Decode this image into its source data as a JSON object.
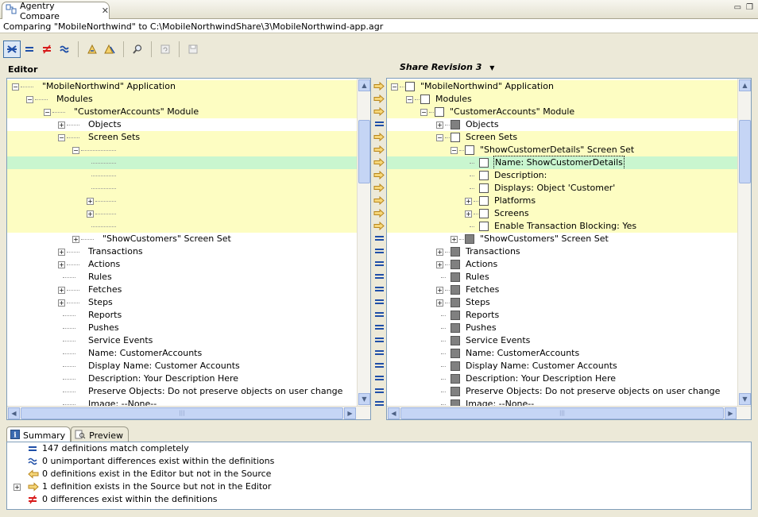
{
  "window": {
    "tab_title": "Agentry Compare",
    "comparing_path": "Comparing \"MobileNorthwind\" to C:\\MobileNorthwindShare\\3\\MobileNorthwind-app.agr"
  },
  "toolbar": {
    "buttons": [
      "show-all",
      "matches",
      "differences",
      "unimportant-differences",
      "copy-left",
      "copy-all",
      "find",
      "refresh",
      "save"
    ]
  },
  "left": {
    "heading": "Editor",
    "rows": [
      {
        "label": "\"MobileNorthwind\" Application",
        "hl": true
      },
      {
        "label": "Modules",
        "hl": true
      },
      {
        "label": "\"CustomerAccounts\" Module",
        "hl": true
      },
      {
        "label": "Objects",
        "hl": false
      },
      {
        "label": "Screen Sets",
        "hl": true
      },
      {
        "label": "",
        "hl": true
      },
      {
        "label": "",
        "hl": "green"
      },
      {
        "label": "",
        "hl": true
      },
      {
        "label": "",
        "hl": true
      },
      {
        "label": "",
        "hl": true
      },
      {
        "label": "",
        "hl": true
      },
      {
        "label": "",
        "hl": true
      },
      {
        "label": "\"ShowCustomers\" Screen Set",
        "hl": false
      },
      {
        "label": "Transactions",
        "hl": false
      },
      {
        "label": "Actions",
        "hl": false
      },
      {
        "label": "Rules",
        "hl": false
      },
      {
        "label": "Fetches",
        "hl": false
      },
      {
        "label": "Steps",
        "hl": false
      },
      {
        "label": "Reports",
        "hl": false
      },
      {
        "label": "Pushes",
        "hl": false
      },
      {
        "label": "Service Events",
        "hl": false
      },
      {
        "label": "Name: CustomerAccounts",
        "hl": false
      },
      {
        "label": "Display Name: Customer Accounts",
        "hl": false
      },
      {
        "label": "Description: Your Description Here",
        "hl": false
      },
      {
        "label": "Preserve Objects: Do not preserve objects on user change",
        "hl": false
      },
      {
        "label": "Image: --None--",
        "hl": false
      }
    ]
  },
  "right": {
    "heading": "Share Revision 3",
    "rows": [
      {
        "label": "\"MobileNorthwind\" Application",
        "hl": true
      },
      {
        "label": "Modules",
        "hl": true
      },
      {
        "label": "\"CustomerAccounts\" Module",
        "hl": true
      },
      {
        "label": "Objects",
        "hl": false
      },
      {
        "label": "Screen Sets",
        "hl": true
      },
      {
        "label": "\"ShowCustomerDetails\" Screen Set",
        "hl": true
      },
      {
        "label": "Name: ShowCustomerDetails",
        "hl": "green"
      },
      {
        "label": "Description:",
        "hl": true
      },
      {
        "label": "Displays: Object 'Customer'",
        "hl": true
      },
      {
        "label": "Platforms",
        "hl": true
      },
      {
        "label": "Screens",
        "hl": true
      },
      {
        "label": "Enable Transaction Blocking: Yes",
        "hl": true
      },
      {
        "label": "\"ShowCustomers\" Screen Set",
        "hl": false
      },
      {
        "label": "Transactions",
        "hl": false
      },
      {
        "label": "Actions",
        "hl": false
      },
      {
        "label": "Rules",
        "hl": false
      },
      {
        "label": "Fetches",
        "hl": false
      },
      {
        "label": "Steps",
        "hl": false
      },
      {
        "label": "Reports",
        "hl": false
      },
      {
        "label": "Pushes",
        "hl": false
      },
      {
        "label": "Service Events",
        "hl": false
      },
      {
        "label": "Name: CustomerAccounts",
        "hl": false
      },
      {
        "label": "Display Name: Customer Accounts",
        "hl": false
      },
      {
        "label": "Description: Your Description Here",
        "hl": false
      },
      {
        "label": "Preserve Objects: Do not preserve objects on user change",
        "hl": false
      },
      {
        "label": "Image: --None--",
        "hl": false
      }
    ]
  },
  "gutter": [
    "arrow",
    "arrow",
    "arrow",
    "eq",
    "arrow",
    "arrow",
    "arrow",
    "arrow",
    "arrow",
    "arrow",
    "arrow",
    "arrow",
    "eq",
    "eq",
    "eq",
    "eq",
    "eq",
    "eq",
    "eq",
    "eq",
    "eq",
    "eq",
    "eq",
    "eq",
    "eq",
    "eq"
  ],
  "bottom": {
    "tabs": [
      "Summary",
      "Preview"
    ],
    "summary": [
      {
        "icon": "equal-icon",
        "text": "147 definitions match completely"
      },
      {
        "icon": "approx-icon",
        "text": "0 unimportant differences exist within the definitions"
      },
      {
        "icon": "arrow-left-icon",
        "text": "0 definitions exist in the Editor but not in the Source"
      },
      {
        "icon": "arrow-right-icon",
        "text": "1 definition exists in the Source but not in the Editor"
      },
      {
        "icon": "not-equal-icon",
        "text": "0 differences exist within the definitions"
      }
    ]
  },
  "colors": {
    "highlight": "#fdfdc2",
    "green": "#c9f6cf",
    "equal_blue": "#1f4fa8",
    "arrow_orange": "#e8a628",
    "diff_red": "#d81c1c"
  }
}
